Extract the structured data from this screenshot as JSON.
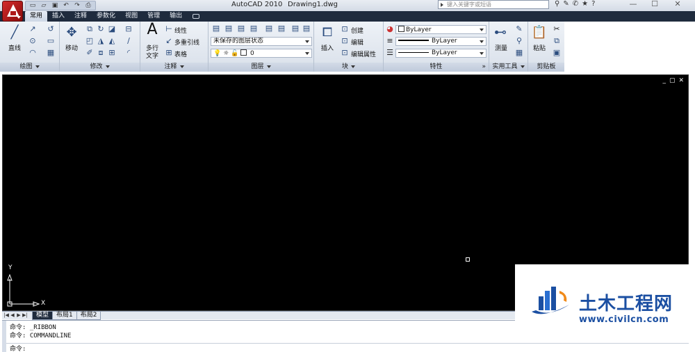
{
  "titlebar": {
    "app_name": "AutoCAD 2010",
    "document": "Drawing1.dwg",
    "search_placeholder": "键入关键字或短语",
    "quick_access": [
      "new-icon",
      "open-icon",
      "save-icon",
      "undo-icon",
      "redo-icon",
      "plot-icon"
    ],
    "window_controls": {
      "minimize": "—",
      "maximize": "☐",
      "close": "✕"
    }
  },
  "tabs": [
    "常用",
    "插入",
    "注释",
    "参数化",
    "视图",
    "管理",
    "输出"
  ],
  "ribbon": {
    "draw": {
      "title": "绘图",
      "line_label": "直线"
    },
    "modify": {
      "title": "修改",
      "move_label": "移动"
    },
    "annotation": {
      "title": "注释",
      "mtext_label_1": "多行",
      "mtext_label_2": "文字",
      "linear_label": "线性",
      "mleader_label": "多重引线",
      "table_label": "表格"
    },
    "layers": {
      "title": "图层",
      "layer_state": "未保存的图层状态",
      "current_layer": "0"
    },
    "block": {
      "title": "块",
      "insert_label": "插入",
      "create_label": "创建",
      "edit_label": "编辑",
      "edit_attr_label": "编辑属性"
    },
    "properties": {
      "title": "特性",
      "color": "ByLayer",
      "lineweight": "ByLayer",
      "linetype": "ByLayer",
      "expand": "»"
    },
    "utilities": {
      "title": "实用工具",
      "measure_label": "测量"
    },
    "clipboard": {
      "title": "剪贴板",
      "paste_label": "粘贴"
    }
  },
  "drawing": {
    "viewport_controls": [
      "_",
      "▢",
      "✕"
    ],
    "ucs_y": "Y",
    "ucs_x": "X"
  },
  "layout_tabs": [
    "模型",
    "布局1",
    "布局2"
  ],
  "command": {
    "history": [
      "命令: _RIBBON",
      "命令: COMMANDLINE"
    ],
    "prompt": "命令:"
  },
  "watermark": {
    "name": "土木工程网",
    "url": "www.civilcn.com"
  },
  "colors": {
    "tab_bar": "#1f2b3d",
    "drawing_bg": "#000000",
    "watermark_blue": "#1b4fa2"
  }
}
